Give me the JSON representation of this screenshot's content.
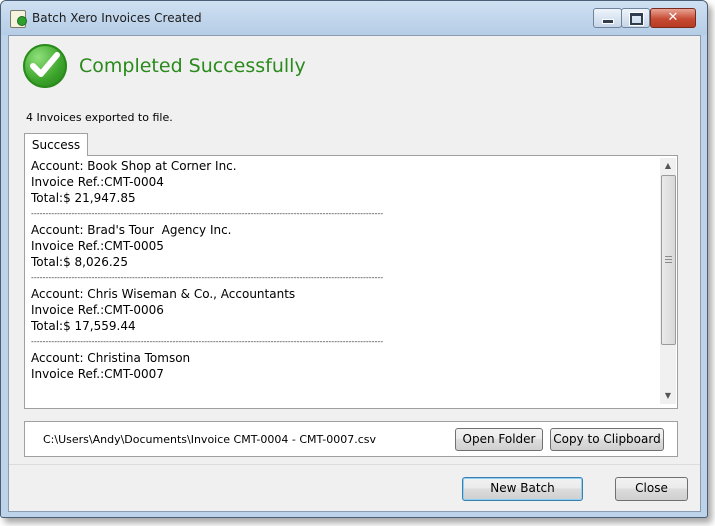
{
  "window": {
    "title": "Batch Xero Invoices Created",
    "controls": {
      "minimize": "minimize",
      "maximize": "maximize",
      "close": "✕"
    }
  },
  "status": {
    "headline": "Completed Successfully",
    "summary": "4 Invoices exported to file.",
    "color": "#2a8a1c"
  },
  "tabs": [
    {
      "label": "Success"
    }
  ],
  "invoices": [
    {
      "account": "Account: Book Shop at Corner Inc.",
      "ref": "Invoice Ref.:CMT-0004",
      "total": "Total:$ 21,947.85"
    },
    {
      "account": "Account: Brad's Tour  Agency Inc.",
      "ref": "Invoice Ref.:CMT-0005",
      "total": "Total:$ 8,026.25"
    },
    {
      "account": "Account: Chris Wiseman & Co., Accountants",
      "ref": "Invoice Ref.:CMT-0006",
      "total": "Total:$ 17,559.44"
    },
    {
      "account": "Account: Christina Tomson",
      "ref": "Invoice Ref.:CMT-0007"
    }
  ],
  "separator": "--------------------------------------------------------------------------------------------------------------------------",
  "file": {
    "path": "C:\\Users\\Andy\\Documents\\Invoice CMT-0004 - CMT-0007.csv",
    "open_folder_label": "Open Folder",
    "copy_label": "Copy to Clipboard"
  },
  "footer": {
    "new_batch_label": "New Batch",
    "close_label": "Close"
  },
  "icons": {
    "app": "app-icon",
    "status": "success-check-icon"
  }
}
